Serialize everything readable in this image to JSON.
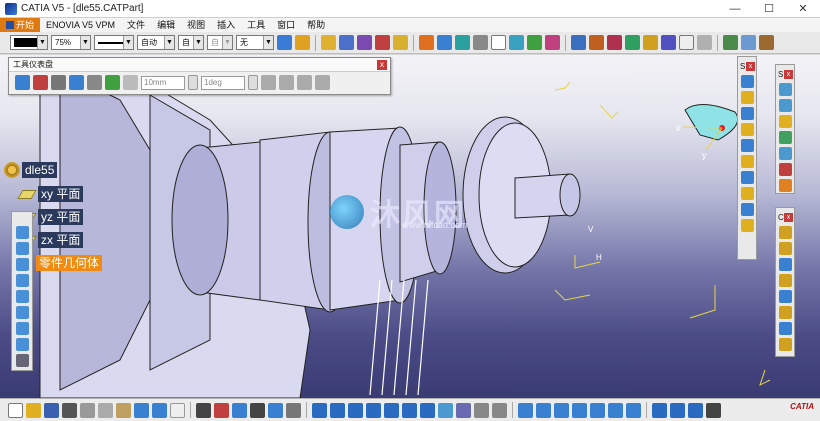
{
  "window": {
    "title": "CATIA V5 - [dle55.CATPart]",
    "minimize": "—",
    "maximize": "☐",
    "close": "✕"
  },
  "menu": [
    "开始",
    "ENOVIA V5 VPM",
    "文件",
    "编辑",
    "视图",
    "插入",
    "工具",
    "窗口",
    "帮助"
  ],
  "toolbar_top": {
    "zoom_value": "75%",
    "line_type_value": "自动",
    "layer_value": "自",
    "layer2_value": "自",
    "none_value": "无"
  },
  "palette": {
    "title": "工具仪表盘",
    "close": "x",
    "length_value": "10mm",
    "angle_value": "1deg"
  },
  "tree": {
    "root": "dle55",
    "items": [
      "xy 平面",
      "yz 平面",
      "zx 平面",
      "零件几何体"
    ],
    "selected_index": 3
  },
  "right_bars": {
    "bar1_label": "S",
    "bar2_label": "S",
    "bar3_label": "C",
    "close": "x"
  },
  "axis_labels": {
    "x": "x",
    "y": "y",
    "h": "H",
    "v": "V"
  },
  "watermark": {
    "text": "沐风网",
    "url": "www.mfcad.com"
  },
  "brand": "CATIA",
  "colors": {
    "accent_orange": "#f08a10",
    "tree_bg": "#2b3a5c",
    "part_fill": "#c9c9ea",
    "viewport_bottom": "#3a3b73"
  }
}
